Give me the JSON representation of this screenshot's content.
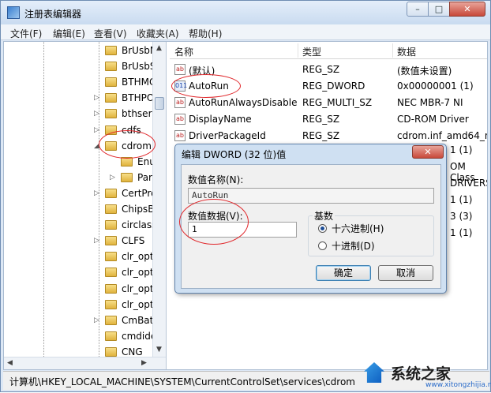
{
  "window": {
    "title": "注册表编辑器",
    "min": "–",
    "max": "□",
    "close": "✕"
  },
  "menu": [
    "文件(F)",
    "编辑(E)",
    "查看(V)",
    "收藏夹(A)",
    "帮助(H)"
  ],
  "tree": {
    "items": [
      {
        "label": "BrUsbM",
        "expand": ""
      },
      {
        "label": "BrUsbS",
        "expand": ""
      },
      {
        "label": "BTHMC",
        "expand": ""
      },
      {
        "label": "BTHPO",
        "expand": "▷"
      },
      {
        "label": "bthserv",
        "expand": "▷"
      },
      {
        "label": "cdfs",
        "expand": "▷"
      },
      {
        "label": "cdrom",
        "expand": "◢"
      },
      {
        "label": "Enu",
        "expand": ""
      },
      {
        "label": "Para",
        "expand": "▷"
      },
      {
        "label": "CertPro",
        "expand": "▷"
      },
      {
        "label": "ChipsBa",
        "expand": ""
      },
      {
        "label": "circlass",
        "expand": ""
      },
      {
        "label": "CLFS",
        "expand": "▷"
      },
      {
        "label": "clr_opti",
        "expand": ""
      },
      {
        "label": "clr_opti",
        "expand": ""
      },
      {
        "label": "clr_opti",
        "expand": ""
      },
      {
        "label": "clr_opti",
        "expand": ""
      },
      {
        "label": "CmBatt",
        "expand": "▷"
      },
      {
        "label": "cmdide",
        "expand": ""
      },
      {
        "label": "CNG",
        "expand": ""
      }
    ],
    "scroll_up": "▲",
    "scroll_down": "▼",
    "scroll_left": "◀",
    "scroll_right": "▶"
  },
  "list": {
    "headers": {
      "name": "名称",
      "type": "类型",
      "data": "数据"
    },
    "rows": [
      {
        "icon": "ab",
        "name": "(默认)",
        "type": "REG_SZ",
        "data": "(数值未设置)"
      },
      {
        "icon": "011",
        "name": "AutoRun",
        "type": "REG_DWORD",
        "data": "0x00000001 (1)"
      },
      {
        "icon": "ab",
        "name": "AutoRunAlwaysDisable",
        "type": "REG_MULTI_SZ",
        "data": "NEC      MBR-7     NI"
      },
      {
        "icon": "ab",
        "name": "DisplayName",
        "type": "REG_SZ",
        "data": "CD-ROM Driver"
      },
      {
        "icon": "ab",
        "name": "DriverPackageId",
        "type": "REG_SZ",
        "data": "cdrom.inf_amd64_n"
      }
    ],
    "partial_data": [
      "1 (1)",
      "OM Class",
      "DRIVERS\\",
      "1 (1)",
      "3 (3)",
      "1 (1)"
    ]
  },
  "dialog": {
    "title": "编辑 DWORD (32 位)值",
    "close": "✕",
    "name_label": "数值名称(N):",
    "name_value": "AutoRun",
    "data_label": "数值数据(V):",
    "data_value": "1",
    "base_label": "基数",
    "hex_label": "十六进制(H)",
    "dec_label": "十进制(D)",
    "ok": "确定",
    "cancel": "取消"
  },
  "status": "计算机\\HKEY_LOCAL_MACHINE\\SYSTEM\\CurrentControlSet\\services\\cdrom",
  "watermark": {
    "text": "系统之家",
    "url": "www.xitongzhijia.net"
  }
}
